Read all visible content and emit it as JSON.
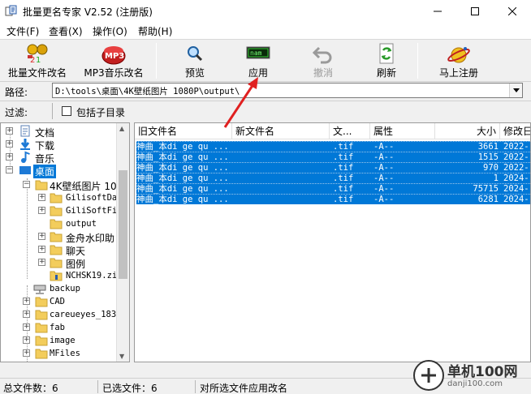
{
  "window": {
    "title": "批量更名专家 V2.52 (注册版)"
  },
  "menu": [
    {
      "label": "文件(F)"
    },
    {
      "label": "查看(X)"
    },
    {
      "label": "操作(O)"
    },
    {
      "label": "帮助(H)"
    }
  ],
  "toolbar": {
    "batch_rename": "批量文件改名",
    "mp3_rename": "MP3音乐改名",
    "preview": "预览",
    "apply": "应用",
    "undo": "撤消",
    "refresh": "刷新",
    "register": "马上注册",
    "apply_icon_text": "nam",
    "mp3_icon_text": "MP3"
  },
  "path": {
    "label": "路径:",
    "value": "D:\\tools\\桌面\\4K壁纸图片 1080P\\output\\"
  },
  "filter": {
    "label": "过滤:",
    "include_subdirs": "包括子目录",
    "include_subdirs_checked": false
  },
  "tree": {
    "items": [
      {
        "label": "文档",
        "icon": "document-icon"
      },
      {
        "label": "下载",
        "icon": "download-icon"
      },
      {
        "label": "音乐",
        "icon": "music-icon"
      },
      {
        "label": "桌面",
        "icon": "desktop-icon",
        "selected": true
      },
      {
        "label": "4K壁纸图片 10",
        "icon": "folder-icon"
      },
      {
        "label": "GilisoftDa",
        "icon": "folder-icon"
      },
      {
        "label": "GiliSoftFi",
        "icon": "folder-icon"
      },
      {
        "label": "output",
        "icon": "folder-icon"
      },
      {
        "label": "金舟水印助",
        "icon": "folder-icon"
      },
      {
        "label": "聊天",
        "icon": "folder-icon"
      },
      {
        "label": "图例",
        "icon": "folder-icon"
      },
      {
        "label": "NCHSK19.zi",
        "icon": "zip-folder-icon"
      },
      {
        "label": "backup",
        "icon": "network-drive-icon"
      },
      {
        "label": "CAD",
        "icon": "folder-icon"
      },
      {
        "label": "careueyes_183",
        "icon": "folder-icon"
      },
      {
        "label": "fab",
        "icon": "folder-icon"
      },
      {
        "label": "image",
        "icon": "folder-icon"
      },
      {
        "label": "MFiles",
        "icon": "folder-icon"
      }
    ]
  },
  "list": {
    "columns": [
      "旧文件名",
      "新文件名",
      "文...",
      "属性",
      "大小",
      "修改日"
    ],
    "rows": [
      {
        "old": "神曲_本di ge qu ...",
        "new": "",
        "ext": ".tif",
        "attr": "-A--",
        "size": "3661",
        "date": "2022-"
      },
      {
        "old": "神曲_本di ge qu ...",
        "new": "",
        "ext": ".tif",
        "attr": "-A--",
        "size": "1515",
        "date": "2022-"
      },
      {
        "old": "神曲_本di ge qu ...",
        "new": "",
        "ext": ".tif",
        "attr": "-A--",
        "size": "970",
        "date": "2022-"
      },
      {
        "old": "神曲_本di ge qu ...",
        "new": "",
        "ext": ".tif",
        "attr": "-A--",
        "size": "1",
        "date": "2024-"
      },
      {
        "old": "神曲_本di ge qu ...",
        "new": "",
        "ext": ".tif",
        "attr": "-A--",
        "size": "75715",
        "date": "2024-"
      },
      {
        "old": "神曲_本di ge qu ...",
        "new": "",
        "ext": ".tif",
        "attr": "-A--",
        "size": "6281",
        "date": "2024-"
      }
    ]
  },
  "status": {
    "total": "总文件数：6",
    "selected": "已选文件：6",
    "hint": "对所选文件应用改名"
  },
  "watermark": {
    "line1": "单机100网",
    "line2": "danji100.com"
  },
  "colors": {
    "selection": "#0078d7",
    "arrow": "#e02020"
  }
}
